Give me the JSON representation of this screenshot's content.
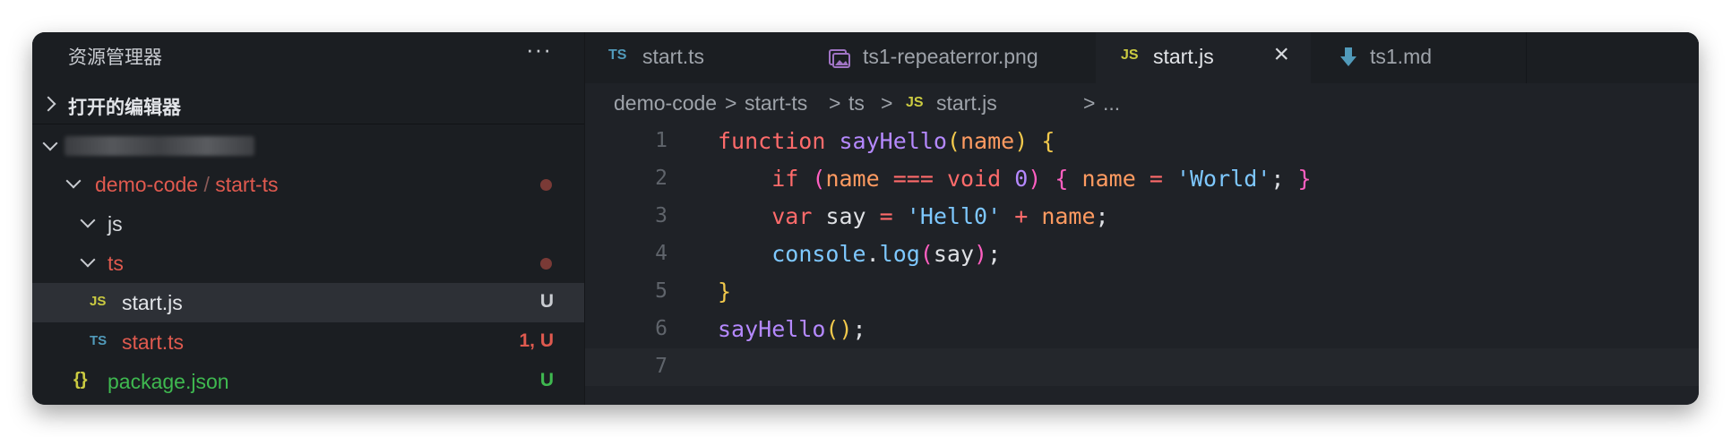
{
  "explorer": {
    "title": "资源管理器",
    "more": "···",
    "open_editors": "打开的编辑器",
    "tree": [
      {
        "label_a": "demo-code",
        "sep": "/",
        "label_b": "start-ts",
        "modified": true
      },
      {
        "label": "js"
      },
      {
        "label": "ts",
        "modified": true
      },
      {
        "type": "JS",
        "label": "start.js",
        "badge": "U",
        "selected": true
      },
      {
        "type": "TS",
        "label": "start.ts",
        "badge": "1, U"
      },
      {
        "type": "{}",
        "label": "package.json",
        "badge": "U"
      }
    ]
  },
  "tabs": [
    {
      "icon": "TS",
      "label": "start.ts"
    },
    {
      "icon": "image",
      "label": "ts1-repeaterror.png"
    },
    {
      "icon": "JS",
      "label": "start.js",
      "active": true,
      "close": "×"
    },
    {
      "icon": "markdown",
      "label": "ts1.md"
    }
  ],
  "breadcrumbs": {
    "items": [
      "demo-code",
      "start-ts",
      "ts"
    ],
    "file_icon": "JS",
    "file": "start.js",
    "ellipsis": "...",
    "separator": ">"
  },
  "code": {
    "line_numbers": [
      "1",
      "2",
      "3",
      "4",
      "5",
      "6",
      "7"
    ],
    "l1": [
      "function",
      "sayHello",
      "(",
      "name",
      ")",
      "{"
    ],
    "l2": [
      "if",
      "(",
      "name",
      "===",
      "void",
      "0",
      ")",
      "{",
      "name",
      "=",
      "'World'",
      ";",
      "}"
    ],
    "l3": [
      "var",
      "say",
      "=",
      "'Hell0'",
      "+",
      "name",
      ";"
    ],
    "l4": [
      "console",
      ".",
      "log",
      "(",
      "say",
      ")",
      ";"
    ],
    "l5": [
      "}"
    ],
    "l6": [
      "sayHello",
      "(",
      ")",
      ";"
    ]
  },
  "colors": {
    "accent_js": "#cbcb41",
    "accent_ts": "#519aba",
    "modified": "#e05a4f",
    "untracked": "#3fb950"
  }
}
